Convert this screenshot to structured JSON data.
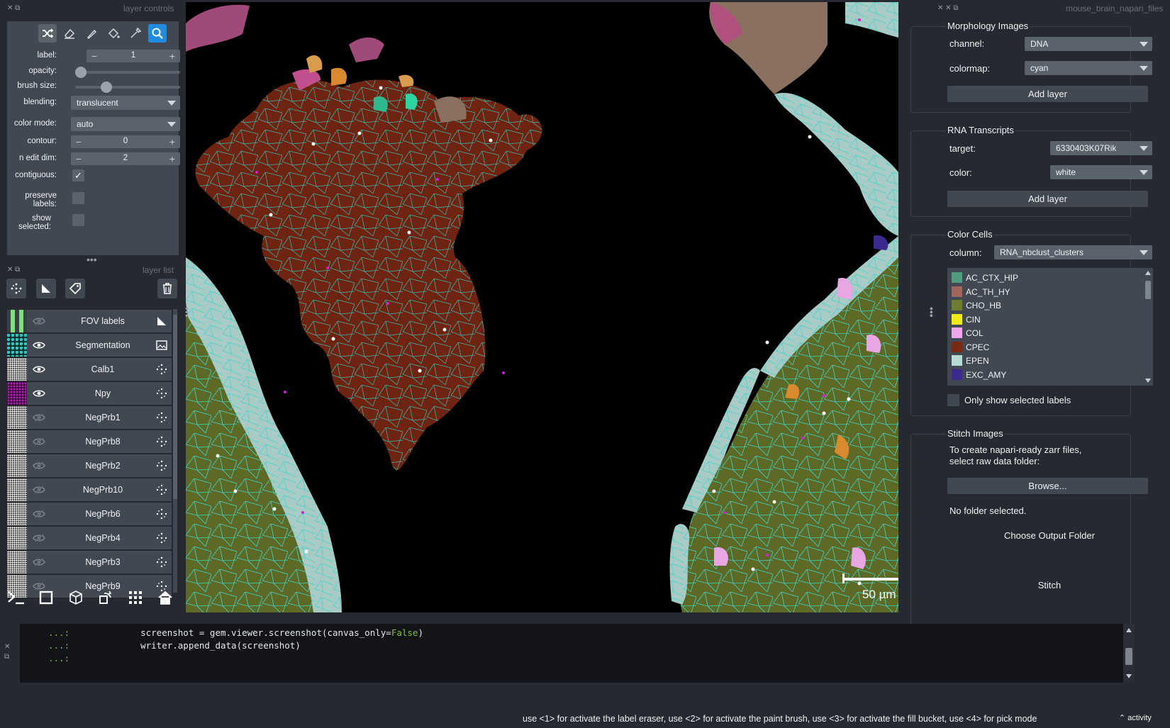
{
  "layer_controls": {
    "title": "layer controls",
    "label": {
      "label": "label:",
      "value": "1"
    },
    "opacity": {
      "label": "opacity:",
      "value": 0.0
    },
    "brush_size": {
      "label": "brush size:",
      "value": 0.27
    },
    "blending": {
      "label": "blending:",
      "value": "translucent"
    },
    "color_mode": {
      "label": "color mode:",
      "value": "auto"
    },
    "contour": {
      "label": "contour:",
      "value": "0"
    },
    "n_edit_dim": {
      "label": "n edit dim:",
      "value": "2"
    },
    "contiguous": {
      "label": "contiguous:",
      "checked": true
    },
    "preserve_labels": {
      "label1": "preserve",
      "label2": "labels:",
      "checked": false
    },
    "show_selected": {
      "label1": "show",
      "label2": "selected:",
      "checked": false
    }
  },
  "layer_list": {
    "title": "layer list",
    "layers": [
      {
        "name": "FOV labels",
        "visible": false,
        "type": "shapes"
      },
      {
        "name": "Segmentation",
        "visible": true,
        "type": "image"
      },
      {
        "name": "Calb1",
        "visible": true,
        "type": "points"
      },
      {
        "name": "Npy",
        "visible": true,
        "type": "points"
      },
      {
        "name": "NegPrb1",
        "visible": false,
        "type": "points"
      },
      {
        "name": "NegPrb8",
        "visible": false,
        "type": "points"
      },
      {
        "name": "NegPrb2",
        "visible": false,
        "type": "points"
      },
      {
        "name": "NegPrb10",
        "visible": false,
        "type": "points"
      },
      {
        "name": "NegPrb6",
        "visible": false,
        "type": "points"
      },
      {
        "name": "NegPrb4",
        "visible": false,
        "type": "points"
      },
      {
        "name": "NegPrb3",
        "visible": false,
        "type": "points"
      },
      {
        "name": "NegPrb9",
        "visible": false,
        "type": "points"
      }
    ]
  },
  "canvas": {
    "scale_bar": "50 µm"
  },
  "dock": {
    "title": "mouse_brain_napari_files",
    "morphology": {
      "title": "Morphology Images",
      "channel_label": "channel:",
      "channel_value": "DNA",
      "colormap_label": "colormap:",
      "colormap_value": "cyan",
      "add_label": "Add layer"
    },
    "rna": {
      "title": "RNA Transcripts",
      "target_label": "target:",
      "target_value": "6330403K07Rik",
      "color_label": "color:",
      "color_value": "white",
      "add_label": "Add layer"
    },
    "color_cells": {
      "title": "Color Cells",
      "column_label": "column:",
      "column_value": "RNA_nbclust_clusters",
      "clusters": [
        {
          "name": "AC_CTX_HIP",
          "color": "#4e9d7c"
        },
        {
          "name": "AC_TH_HY",
          "color": "#a0675a"
        },
        {
          "name": "CHO_HB",
          "color": "#6f7d2e"
        },
        {
          "name": "CIN",
          "color": "#f2e91a"
        },
        {
          "name": "COL",
          "color": "#f0a6ea"
        },
        {
          "name": "CPEC",
          "color": "#7b2a12"
        },
        {
          "name": "EPEN",
          "color": "#b7dcd6"
        },
        {
          "name": "EXC_AMY",
          "color": "#3d2a8f"
        }
      ],
      "only_selected_label": "Only show selected labels"
    },
    "stitch": {
      "title": "Stitch Images",
      "desc1": "To create napari-ready zarr files,",
      "desc2": "select raw data folder:",
      "browse_label": "Browse...",
      "no_folder": "No folder selected.",
      "choose_output": "Choose Output Folder",
      "stitch_label": "Stitch"
    }
  },
  "console": {
    "lines": [
      {
        "prompt": "...:",
        "code_a": "    screenshot = gem.viewer.screenshot(canvas_only=",
        "kw": "False",
        "code_b": ")"
      },
      {
        "prompt": "...:",
        "code_a": "    writer.append_data(screenshot)",
        "kw": "",
        "code_b": ""
      },
      {
        "prompt": "...:",
        "code_a": "",
        "kw": "",
        "code_b": ""
      }
    ]
  },
  "status": {
    "message": "use <1> for activate the label eraser, use <2> for activate the paint brush, use <3> for activate the fill bucket, use <4> for pick mode",
    "activity": "activity"
  }
}
